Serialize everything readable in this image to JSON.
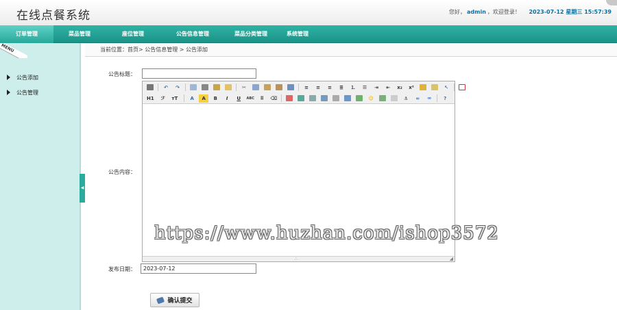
{
  "app": {
    "title": "在线点餐系统"
  },
  "header": {
    "greeting_prefix": "您好，",
    "username": "admin",
    "greeting_suffix": "，欢迎登录！",
    "datetime": "2023-07-12 星期三 15:57:39"
  },
  "nav": {
    "items": [
      {
        "label": "订单管理",
        "active": true
      },
      {
        "label": "菜品管理"
      },
      {
        "label": "座位管理"
      },
      {
        "label": "公告信息管理"
      },
      {
        "label": "菜品分类管理"
      },
      {
        "label": "系统管理"
      }
    ]
  },
  "sidebar": {
    "menu_label": "MENU",
    "items": [
      {
        "label": "公告添加"
      },
      {
        "label": "公告管理"
      }
    ],
    "collapse_glyph": "◀"
  },
  "breadcrumb": {
    "text": "当前位置：首页> 公告信息管理 > 公告添加"
  },
  "form": {
    "title_label": "公告标题：",
    "title_value": "",
    "content_label": "公告内容：",
    "date_label": "发布日期：",
    "date_value": "2023-07-12",
    "submit_label": "确认提交"
  },
  "editor": {
    "toolbar_row1": [
      "source-icon",
      "undo-icon",
      "redo-icon",
      "preview-icon",
      "print-icon",
      "template-icon",
      "code-icon",
      "cut-icon",
      "copy-icon",
      "paste-icon",
      "paste-text-icon",
      "paste-word-icon",
      "align-left-icon",
      "align-center-icon",
      "align-right-icon",
      "justify-icon",
      "ordered-list-icon",
      "unordered-list-icon",
      "indent-icon",
      "outdent-icon",
      "subscript-icon",
      "superscript-icon",
      "clear-format-icon",
      "select-all-icon",
      "quick-format-icon",
      "fullscreen-icon"
    ],
    "toolbar_row2_text": {
      "heading": "H1",
      "font_family": "ℱ",
      "font_size": "тT",
      "font_color": "A",
      "highlight": "A",
      "bold": "B",
      "italic": "I",
      "underline": "U",
      "strike": "ABC"
    },
    "toolbar_row2_icons": [
      "line-height-icon",
      "remove-format-icon",
      "image-icon",
      "multi-image-icon",
      "flash-icon",
      "media-icon",
      "file-icon",
      "table-icon",
      "hr-icon",
      "emoticon-icon",
      "map-icon",
      "page-break-icon",
      "anchor-icon",
      "link-icon",
      "unlink-icon",
      "help-icon"
    ],
    "grip_glyph": "∴",
    "resize_glyph": "◢"
  },
  "watermark": {
    "text": "https://www.huzhan.com/ishop3572"
  },
  "colors": {
    "nav_teal": "#1fa193",
    "sidebar_bg": "#cdeeea",
    "link_blue": "#0b6fa4"
  }
}
